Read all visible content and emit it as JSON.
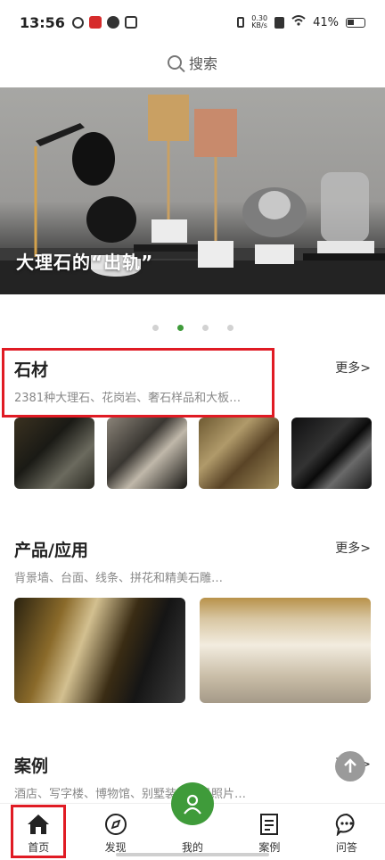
{
  "status_bar": {
    "time": "13:56",
    "speed": "0.30\nKB/s",
    "battery": "41%"
  },
  "search": {
    "label": "搜索"
  },
  "banner": {
    "title": "大理石的“出轨”",
    "page_count": 4,
    "active_index": 1
  },
  "sections": [
    {
      "title": "石材",
      "more": "更多>",
      "desc": "2381种大理石、花岗岩、奢石样品和大板…"
    },
    {
      "title": "产品/应用",
      "more": "更多>",
      "desc": "背景墙、台面、线条、拼花和精美石雕…"
    },
    {
      "title": "案例",
      "more": "更多>",
      "desc": "酒店、写字楼、博物馆、别墅装修实景照片…"
    }
  ],
  "nav": [
    {
      "label": "首页",
      "icon": "home-icon"
    },
    {
      "label": "发现",
      "icon": "compass-icon"
    },
    {
      "label": "我的",
      "icon": "user-icon"
    },
    {
      "label": "案例",
      "icon": "document-icon"
    },
    {
      "label": "问答",
      "icon": "chat-icon"
    }
  ],
  "colors": {
    "accent": "#3f9b3a",
    "highlight": "#e01b24"
  }
}
